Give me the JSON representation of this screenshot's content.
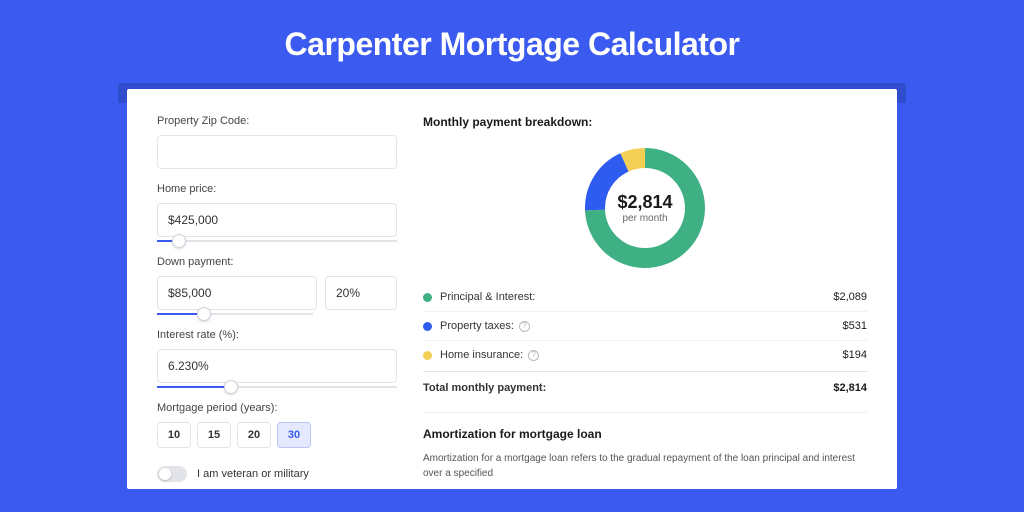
{
  "page": {
    "title": "Carpenter Mortgage Calculator"
  },
  "form": {
    "zip": {
      "label": "Property Zip Code:",
      "value": ""
    },
    "home_price": {
      "label": "Home price:",
      "value": "$425,000",
      "slider_pct": 9
    },
    "down_payment": {
      "label": "Down payment:",
      "value": "$85,000",
      "pct_value": "20%",
      "slider_pct": 20
    },
    "interest_rate": {
      "label": "Interest rate (%):",
      "value": "6.230%",
      "slider_pct": 31
    },
    "period": {
      "label": "Mortgage period (years):",
      "options": [
        "10",
        "15",
        "20",
        "30"
      ],
      "selected": "30"
    },
    "veteran": {
      "label": "I am veteran or military",
      "checked": false
    }
  },
  "breakdown": {
    "heading": "Monthly payment breakdown:",
    "total_display": "$2,814",
    "per_month": "per month",
    "items": [
      {
        "label": "Principal & Interest:",
        "value": "$2,089",
        "color": "#3faf84",
        "info": false
      },
      {
        "label": "Property taxes:",
        "value": "$531",
        "color": "#2e5bf0",
        "info": true
      },
      {
        "label": "Home insurance:",
        "value": "$194",
        "color": "#f3cf56",
        "info": true
      }
    ],
    "total_row": {
      "label": "Total monthly payment:",
      "value": "$2,814"
    }
  },
  "chart_data": {
    "type": "pie",
    "title": "Monthly payment breakdown",
    "series": [
      {
        "name": "Principal & Interest",
        "value": 2089,
        "color": "#3faf84"
      },
      {
        "name": "Property taxes",
        "value": 531,
        "color": "#2e5bf0"
      },
      {
        "name": "Home insurance",
        "value": 194,
        "color": "#f3cf56"
      }
    ],
    "total": 2814,
    "center_label": "$2,814",
    "center_sub": "per month"
  },
  "amortization": {
    "title": "Amortization for mortgage loan",
    "body": "Amortization for a mortgage loan refers to the gradual repayment of the loan principal and interest over a specified"
  }
}
